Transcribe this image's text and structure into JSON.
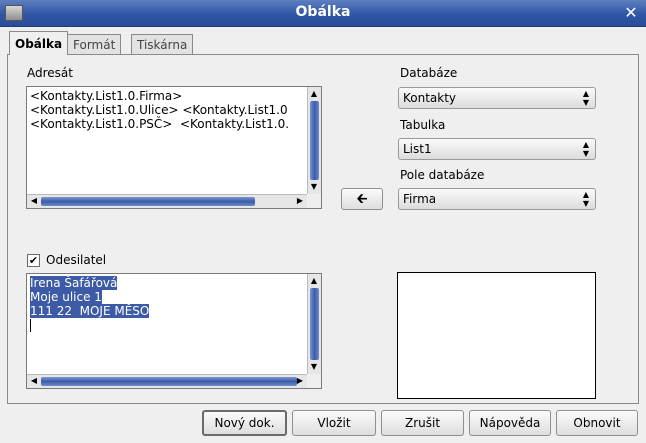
{
  "window": {
    "title": "Obálka"
  },
  "tabs": [
    {
      "label": "Obálka"
    },
    {
      "label": "Formát"
    },
    {
      "label": "Tiskárna"
    }
  ],
  "addressee": {
    "label": "Adresát",
    "lines": [
      "<Kontakty.List1.0.Firma>",
      "<Kontakty.List1.0.Ulice> <Kontakty.List1.0",
      "<Kontakty.List1.0.PSČ>  <Kontakty.List1.0."
    ]
  },
  "database": {
    "label": "Databáze",
    "value": "Kontakty"
  },
  "table": {
    "label": "Tabulka",
    "value": "List1"
  },
  "field": {
    "label": "Pole databáze",
    "value": "Firma"
  },
  "insert_field_icon": "arrow-left-icon",
  "sender": {
    "label": "Odesilatel",
    "checked": true,
    "lines": [
      "Irena Šafářová",
      "Moje ulice 1",
      "111 22  MOJE MĚSO"
    ]
  },
  "buttons": {
    "new_doc": "Nový dok.",
    "insert": "Vložit",
    "cancel": "Zrušit",
    "help": "Nápověda",
    "reset": "Obnovit"
  },
  "colors": {
    "titlebar": "#2f56a6",
    "selection": "#3c5aa5"
  }
}
